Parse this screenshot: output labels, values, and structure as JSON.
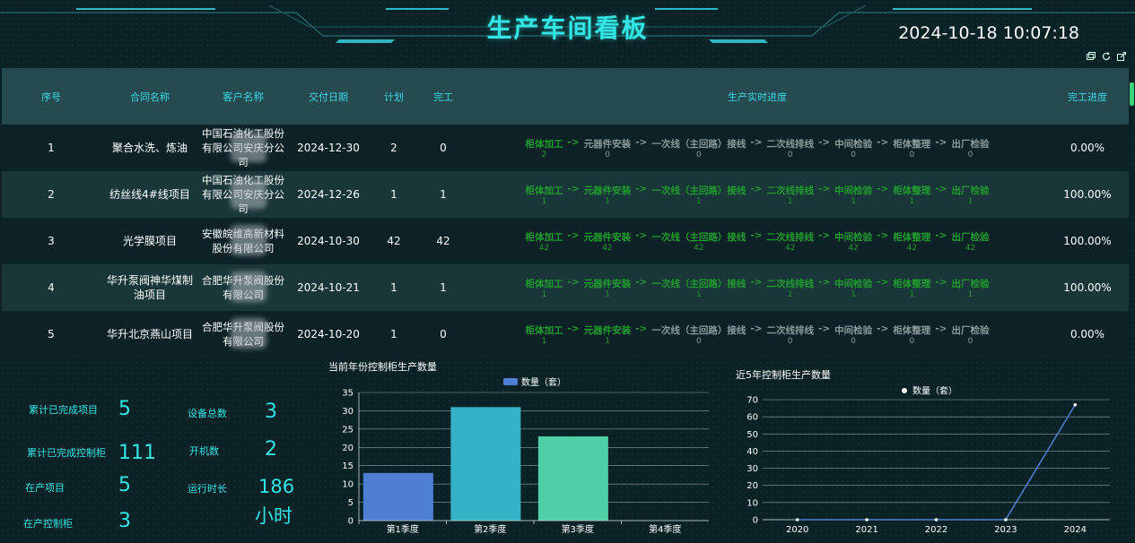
{
  "header": {
    "title": "生产车间看板",
    "datetime": "2024-10-18 10:07:18"
  },
  "toolbar_icons": [
    "restore-icon",
    "refresh-icon",
    "export-icon"
  ],
  "table": {
    "columns": [
      "序号",
      "合同名称",
      "客户名称",
      "交付日期",
      "计划",
      "完工",
      "生产实时进度",
      "完工进度"
    ],
    "stage_names": [
      "柜体加工",
      "元器件安装",
      "一次线（主回路）接线",
      "二次线排线",
      "中间检验",
      "柜体整理",
      "出厂检验"
    ],
    "arrow": "->",
    "rows": [
      {
        "seq": "1",
        "name": "聚合水洗、炼油",
        "customer": "中国石油化工股份有限公司安庆分公司",
        "date": "2024-12-30",
        "plan": "2",
        "done": "0",
        "stages": [
          "2",
          "0",
          "0",
          "0",
          "0",
          "0",
          "0"
        ],
        "stage_done": [
          true,
          false,
          false,
          false,
          false,
          false,
          false
        ],
        "pct": "0.00%"
      },
      {
        "seq": "2",
        "name": "纺丝线4#线项目",
        "customer": "中国石油化工股份有限公司安庆分公司",
        "date": "2024-12-26",
        "plan": "1",
        "done": "1",
        "stages": [
          "1",
          "1",
          "1",
          "1",
          "1",
          "1",
          "1"
        ],
        "stage_done": [
          true,
          true,
          true,
          true,
          true,
          true,
          true
        ],
        "pct": "100.00%"
      },
      {
        "seq": "3",
        "name": "光学膜项目",
        "customer": "安徽皖维高新材料股份有限公司",
        "date": "2024-10-30",
        "plan": "42",
        "done": "42",
        "stages": [
          "42",
          "42",
          "42",
          "42",
          "42",
          "42",
          "42"
        ],
        "stage_done": [
          true,
          true,
          true,
          true,
          true,
          true,
          true
        ],
        "pct": "100.00%"
      },
      {
        "seq": "4",
        "name": "华升泵阀神华煤制油项目",
        "customer": "合肥华升泵阀股份有限公司",
        "date": "2024-10-21",
        "plan": "1",
        "done": "1",
        "stages": [
          "1",
          "1",
          "1",
          "1",
          "1",
          "1",
          "1"
        ],
        "stage_done": [
          true,
          true,
          true,
          true,
          true,
          true,
          true
        ],
        "pct": "100.00%"
      },
      {
        "seq": "5",
        "name": "华升北京燕山项目",
        "customer": "合肥华升泵阀股份有限公司",
        "date": "2024-10-20",
        "plan": "1",
        "done": "0",
        "stages": [
          "1",
          "1",
          "0",
          "0",
          "0",
          "0",
          "0"
        ],
        "stage_done": [
          true,
          true,
          false,
          false,
          false,
          false,
          false
        ],
        "pct": "0.00%"
      }
    ]
  },
  "stats": {
    "completed_projects_label": "累计已完成项目",
    "completed_projects": "5",
    "completed_cabinets_label": "累计已完成控制柜",
    "completed_cabinets": "111",
    "active_projects_label": "在产项目",
    "active_projects": "5",
    "active_cabinets_label": "在产控制柜",
    "active_cabinets": "3",
    "devices_label": "设备总数",
    "devices": "3",
    "running_label": "开机数",
    "running": "2",
    "runtime_label": "运行时长",
    "runtime": "186",
    "runtime_unit": "小时"
  },
  "chart_data": [
    {
      "type": "bar",
      "title": "当前年份控制柜生产数量",
      "categories": [
        "第1季度",
        "第2季度",
        "第3季度",
        "第4季度"
      ],
      "series": [
        {
          "name": "数量（套）",
          "values": [
            13,
            31,
            23,
            0
          ]
        }
      ],
      "bar_colors": [
        "#4f7fd3",
        "#34b3c6",
        "#4fcfa5",
        "#4f7fd3"
      ],
      "legend_color": "#4f7fd3",
      "ylim": [
        0,
        35
      ],
      "yticks": [
        0,
        5,
        10,
        15,
        20,
        25,
        30,
        35
      ],
      "legend": "top-center",
      "grid": true
    },
    {
      "type": "line",
      "title": "近5年控制柜生产数量",
      "categories": [
        "2020",
        "2021",
        "2022",
        "2023",
        "2024"
      ],
      "series": [
        {
          "name": "数量（套）",
          "values": [
            0,
            0,
            0,
            0,
            67
          ]
        }
      ],
      "line_color": "#4f7fd3",
      "legend_color": "#ffffff",
      "ylim": [
        0,
        70
      ],
      "yticks": [
        0,
        10,
        20,
        30,
        40,
        50,
        60,
        70
      ],
      "legend": "top-center",
      "grid": true
    }
  ]
}
